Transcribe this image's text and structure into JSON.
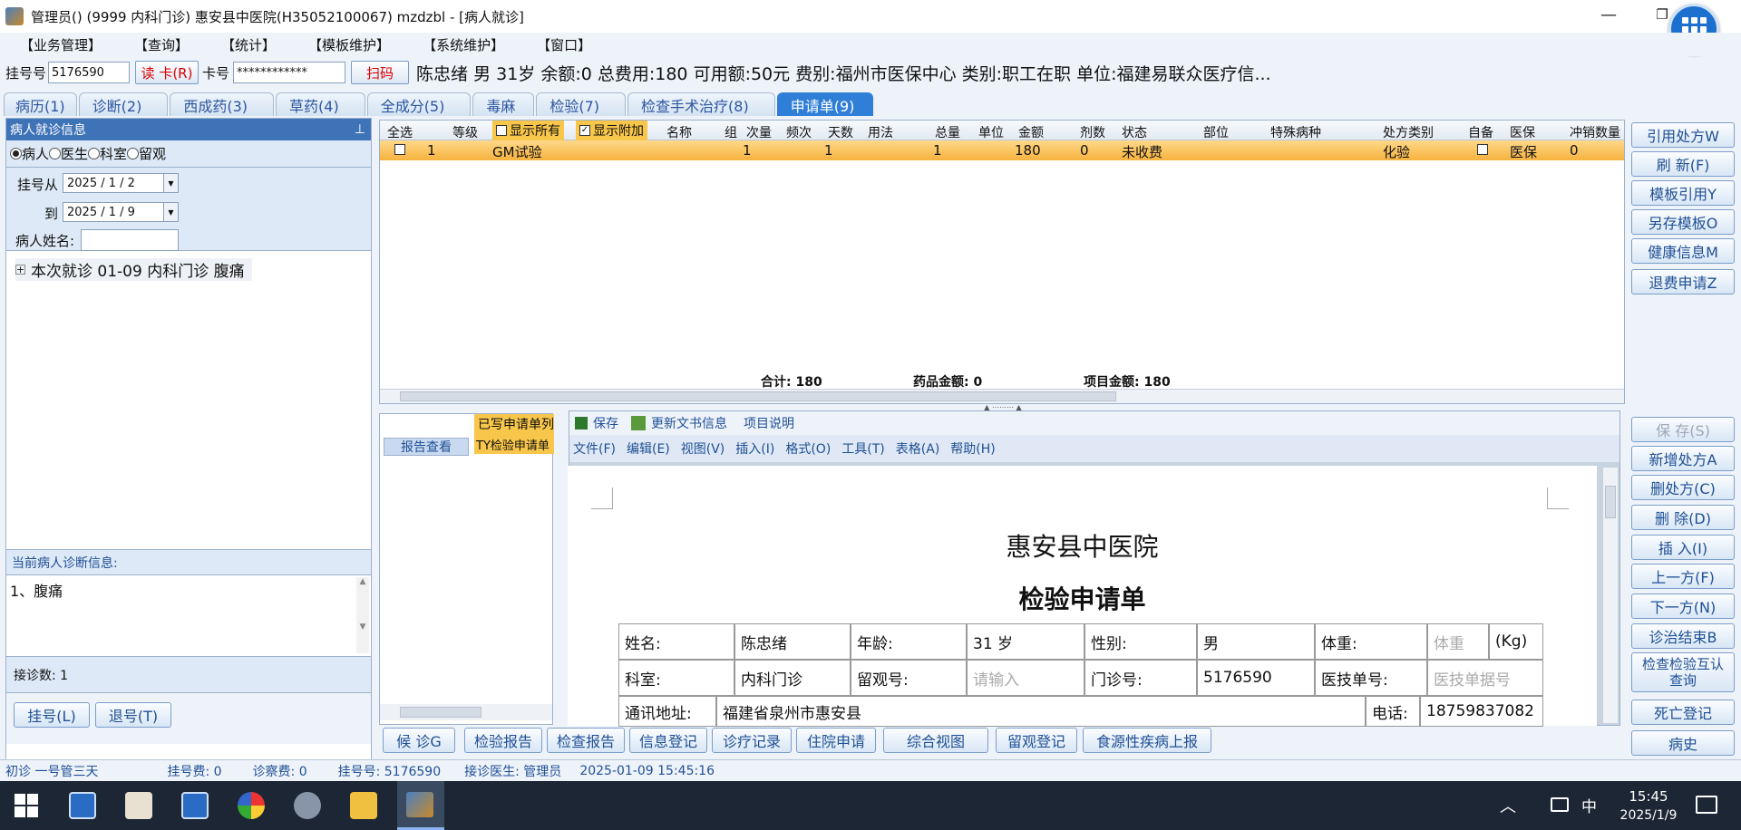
{
  "window": {
    "title": "管理员() (9999 内科门诊) 惠安县中医院(H35052100067) mzdzbl - [病人就诊]"
  },
  "menu": [
    "【业务管理】",
    "【查询】",
    "【统计】",
    "【模板维护】",
    "【系统维护】",
    "【窗口】"
  ],
  "infobar": {
    "reg_label": "挂号号",
    "reg_value": "5176590",
    "read_card": "读 卡(R)",
    "card_label": "卡号",
    "card_value": "************",
    "scan": "扫码",
    "patient_info": "陈忠绪  男  31岁  余额:0 总费用:180  可用额:50元  费别:福州市医保中心  类别:职工在职  单位:福建易联众医疗信..."
  },
  "tabs": [
    "病历(1)",
    "诊断(2)",
    "西成药(3)",
    "草药(4)",
    "全成分(5)",
    "毒麻",
    "检验(7)",
    "检查手术治疗(8)",
    "申请单(9)"
  ],
  "left": {
    "header": "病人就诊信息",
    "pin": "ᵖ",
    "radios": [
      "病人",
      "医生",
      "科室",
      "留观"
    ],
    "reg_from": "挂号从",
    "date_from": "2025 / 1 / 2",
    "to": "到",
    "date_to": "2025 / 1 / 9",
    "name_label": "病人姓名:",
    "tree_item": "本次就诊 01-09 内科门诊 腹痛",
    "diag_header": "当前病人诊断信息:",
    "diag_text": "1、腹痛",
    "count": "接诊数: 1",
    "reg_btn": "挂号(L)",
    "unreg_btn": "退号(T)"
  },
  "grid": {
    "headers": [
      "全选",
      "等级",
      "显示所有",
      "显示附加",
      "名称",
      "组",
      "次量",
      "频次",
      "天数",
      "用法",
      "总量",
      "单位",
      "金额",
      "剂数",
      "状态",
      "部位",
      "特殊病种",
      "处方类别",
      "自备",
      "医保",
      "冲销数量"
    ],
    "row": {
      "grade": "1",
      "name": "GM试验",
      "qty": "1",
      "days": "1",
      "total": "1",
      "amount": "180",
      "doses": "0",
      "status": "未收费",
      "category": "化验",
      "insurance": "医保",
      "offset": "0"
    },
    "sum": "合计:  180",
    "drug_sum": "药品金额:  0",
    "item_sum": "项目金额:  180"
  },
  "right_buttons": [
    "引用处方W",
    "刷  新(F)",
    "模板引用Y",
    "另存模板O",
    "健康信息M",
    "退费申请Z"
  ],
  "right_buttons2": [
    "保  存(S)",
    "新增处方A",
    "删处方(C)",
    "删  除(D)",
    "插  入(I)",
    "上一方(F)",
    "下一方(N)",
    "诊治结束B",
    "检查检验互认查询",
    "死亡登记",
    "病史"
  ],
  "report": {
    "written_tab": "已写申请单列",
    "report_view": "报告查看",
    "item": "TY检验申请单"
  },
  "doc_toolbar": {
    "save": "保存",
    "update": "更新文书信息",
    "explain": "项目说明"
  },
  "doc_menu": [
    "文件(F)",
    "编辑(E)",
    "视图(V)",
    "插入(I)",
    "格式(O)",
    "工具(T)",
    "表格(A)",
    "帮助(H)"
  ],
  "doc": {
    "hospital": "惠安县中医院",
    "title": "检验申请单",
    "row1": [
      "姓名:",
      "陈忠绪",
      "年龄:",
      "31 岁",
      "性别:",
      "男",
      "体重:",
      "体重",
      "(Kg)"
    ],
    "row2": [
      "科室:",
      "内科门诊",
      "留观号:",
      "请输入",
      "门诊号:",
      "5176590",
      "医技单号:",
      "医技单据号"
    ],
    "row3": [
      "通讯地址:",
      "福建省泉州市惠安县",
      "电话:",
      "18759837082"
    ]
  },
  "bottom_buttons": [
    "候  诊G",
    "检验报告",
    "检查报告",
    "信息登记",
    "诊疗记录",
    "住院申请",
    "综合视图",
    "留观登记",
    "食源性疾病上报"
  ],
  "status": {
    "visit": "初诊 一号管三天",
    "reg_fee": "挂号费:   0",
    "diag_fee": "诊察费:   0",
    "reg_no": "挂号号:    5176590",
    "doctor": "接诊医生:   管理员",
    "time": "2025-01-09 15:45:16"
  },
  "taskbar": {
    "ime": "中",
    "time": "15:45",
    "date": "2025/1/9"
  }
}
